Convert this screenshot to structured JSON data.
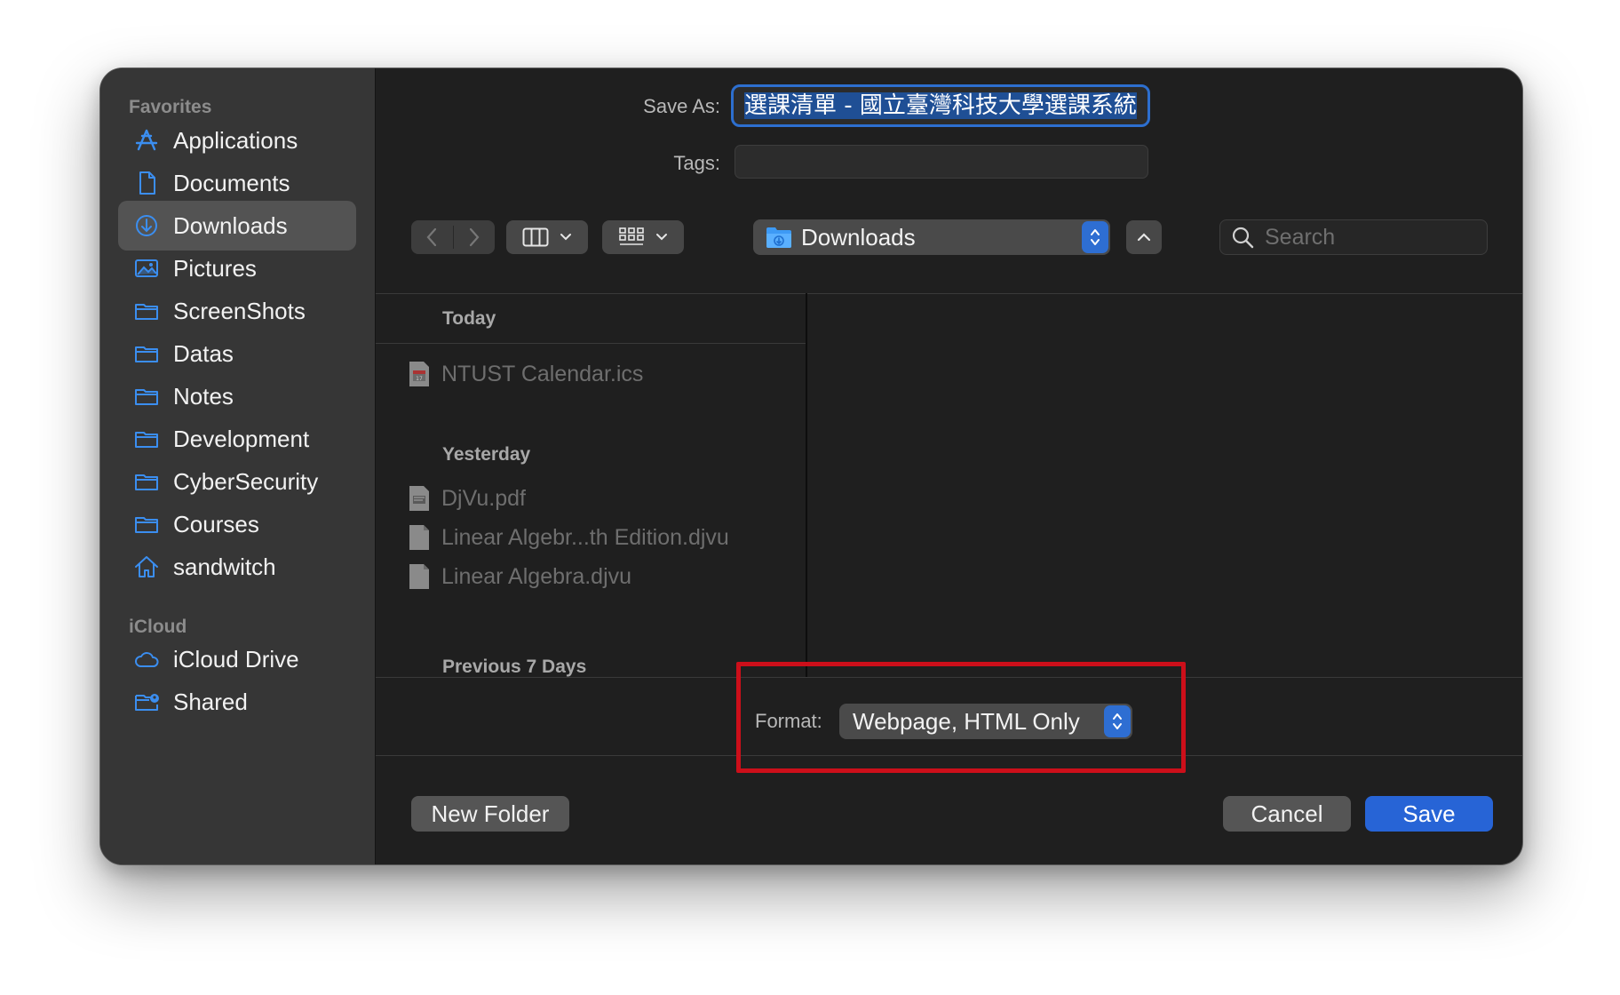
{
  "sidebar": {
    "favorites_header": "Favorites",
    "favorites": [
      {
        "label": "Applications",
        "icon": "applications-icon"
      },
      {
        "label": "Documents",
        "icon": "document-icon"
      },
      {
        "label": "Downloads",
        "icon": "downloads-icon",
        "selected": true
      },
      {
        "label": "Pictures",
        "icon": "pictures-icon"
      },
      {
        "label": "ScreenShots",
        "icon": "folder-icon"
      },
      {
        "label": "Datas",
        "icon": "folder-icon"
      },
      {
        "label": "Notes",
        "icon": "folder-icon"
      },
      {
        "label": "Development",
        "icon": "folder-icon"
      },
      {
        "label": "CyberSecurity",
        "icon": "folder-icon"
      },
      {
        "label": "Courses",
        "icon": "folder-icon"
      },
      {
        "label": "sandwitch",
        "icon": "home-icon"
      }
    ],
    "icloud_header": "iCloud",
    "icloud": [
      {
        "label": "iCloud Drive",
        "icon": "cloud-icon"
      },
      {
        "label": "Shared",
        "icon": "shared-folder-icon"
      }
    ]
  },
  "form": {
    "save_as_label": "Save As:",
    "save_as_value": "選課清單 - 國立臺灣科技大學選課系統",
    "tags_label": "Tags:",
    "tags_value": ""
  },
  "toolbar": {
    "location": "Downloads",
    "search_placeholder": "Search"
  },
  "browser": {
    "groups": [
      {
        "header": "Today",
        "files": [
          {
            "name": "NTUST Calendar.ics",
            "icon": "calendar-file-icon"
          }
        ]
      },
      {
        "header": "Yesterday",
        "files": [
          {
            "name": "DjVu.pdf",
            "icon": "pdf-file-icon"
          },
          {
            "name": "Linear Algebr...th Edition.djvu",
            "icon": "file-icon"
          },
          {
            "name": "Linear Algebra.djvu",
            "icon": "file-icon"
          }
        ]
      },
      {
        "header": "Previous 7 Days",
        "files": []
      }
    ]
  },
  "format": {
    "label": "Format:",
    "value": "Webpage, HTML Only"
  },
  "buttons": {
    "new_folder": "New Folder",
    "cancel": "Cancel",
    "save": "Save"
  },
  "colors": {
    "accent": "#2764d6",
    "highlight_box": "#cc0f1a",
    "sidebar_icon": "#3b8ef0"
  }
}
